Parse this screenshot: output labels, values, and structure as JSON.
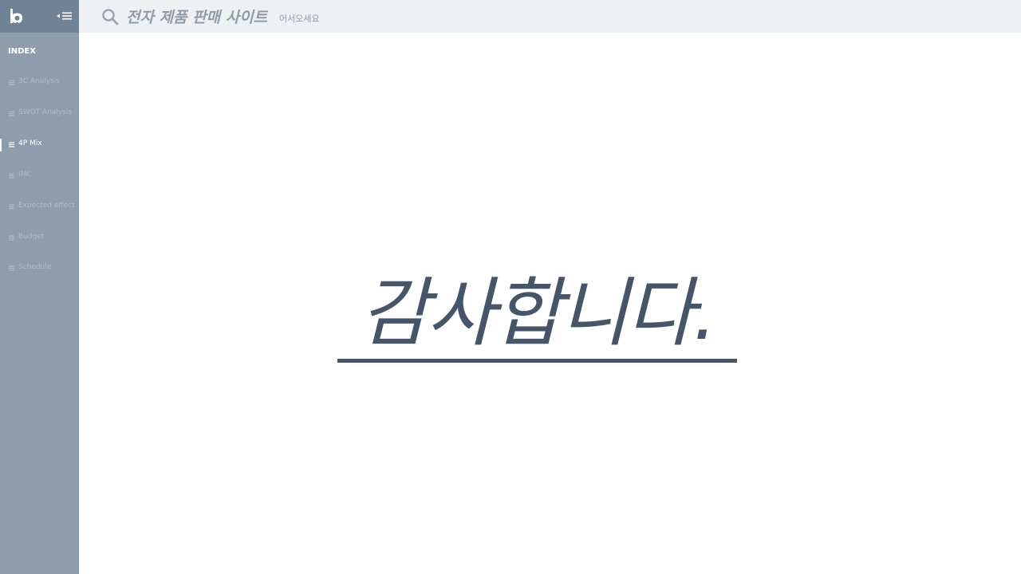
{
  "sidebar": {
    "index_label": "INDEX",
    "items": [
      {
        "label": "3C Analysis",
        "active": false
      },
      {
        "label": "SWOT Analysis",
        "active": false
      },
      {
        "label": "4P Mix",
        "active": true
      },
      {
        "label": "IMC",
        "active": false
      },
      {
        "label": "Expected  effect",
        "active": false
      },
      {
        "label": "Budget",
        "active": false
      },
      {
        "label": "Schedule",
        "active": false
      }
    ]
  },
  "topbar": {
    "title": "전자 제품 판매 사이트",
    "subtitle": "어서오세요"
  },
  "main": {
    "thanks": "감사합니다."
  },
  "colors": {
    "sidebar_bg": "#8e9cac",
    "sidebar_header_bg": "#728296",
    "topbar_bg": "#edf1f4",
    "heading_color": "#46566a",
    "muted_text": "#8f9ba8"
  }
}
